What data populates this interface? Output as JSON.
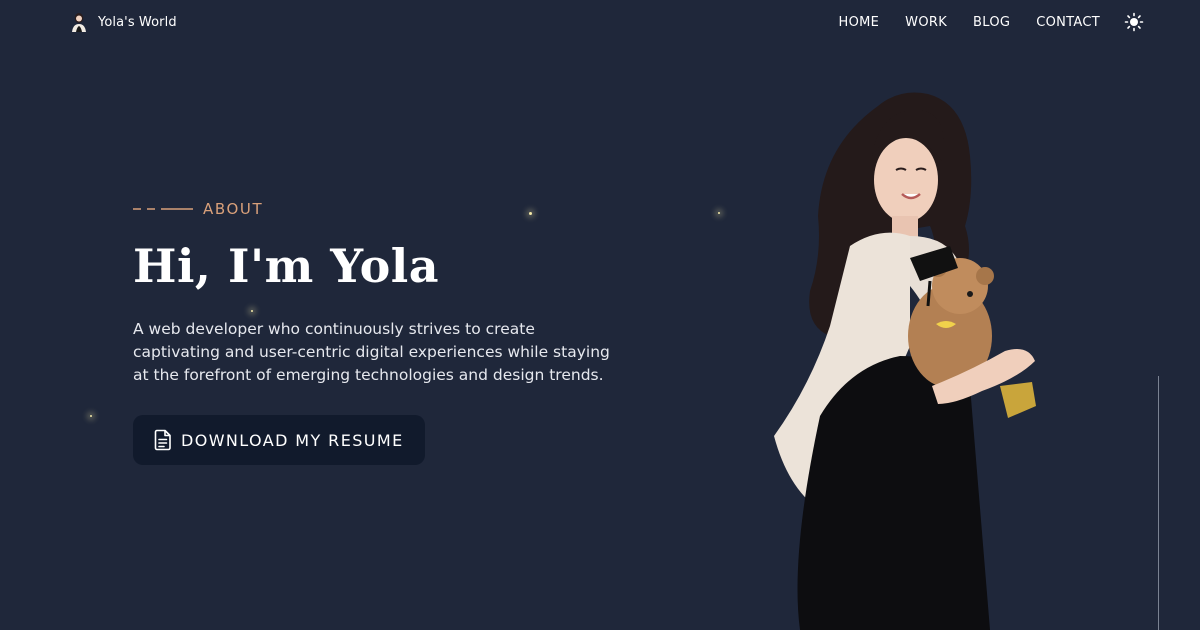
{
  "header": {
    "brand_name": "Yola's World",
    "brand_logo_icon": "avatar-logo-icon",
    "nav": [
      {
        "label": "HOME"
      },
      {
        "label": "WORK"
      },
      {
        "label": "BLOG"
      },
      {
        "label": "CONTACT"
      }
    ],
    "theme_toggle_icon": "sun-icon"
  },
  "hero": {
    "eyebrow": "ABOUT",
    "title": "Hi, I'm Yola",
    "bio": "A web developer who continuously strives to create captivating and user-centric digital experiences while staying at the forefront of emerging technologies and design trends.",
    "button_label": "DOWNLOAD MY RESUME",
    "button_icon": "document-icon"
  },
  "colors": {
    "background": "#1f273a",
    "accent": "#d9a07a",
    "button_background": "#111a2c",
    "text": "#ffffff"
  }
}
